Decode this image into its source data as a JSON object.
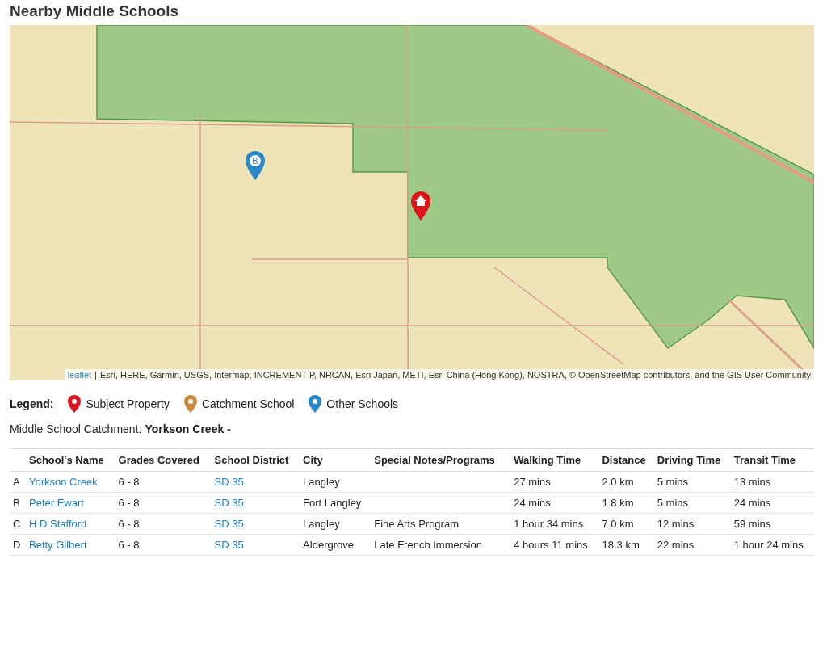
{
  "title": "Nearby Middle Schools",
  "map": {
    "markers": [
      {
        "kind": "school",
        "label": "B",
        "color": "#2a88c9"
      },
      {
        "kind": "property",
        "color": "#e0131b"
      }
    ],
    "attribution": {
      "link": "leaflet",
      "separator": "|",
      "text": "Esri, HERE, Garmin, USGS, Intermap, INCREMENT P, NRCAN, Esri Japan, METI, Esri China (Hong Kong), NOSTRA, © OpenStreetMap contributors, and the GIS User Community"
    }
  },
  "legend": {
    "label": "Legend:",
    "items": [
      {
        "label": "Subject Property",
        "color": "#e0131b"
      },
      {
        "label": "Catchment School",
        "color": "#c98b3b"
      },
      {
        "label": "Other Schools",
        "color": "#2a88c9"
      }
    ]
  },
  "catchment": {
    "label": "Middle School Catchment:",
    "value": "Yorkson Creek -"
  },
  "table": {
    "columns": [
      "School's Name",
      "Grades Covered",
      "School District",
      "City",
      "Special Notes/Programs",
      "Walking Time",
      "Distance",
      "Driving Time",
      "Transit Time"
    ],
    "rows": [
      {
        "letter": "A",
        "name": "Yorkson Creek",
        "grades": "6 - 8",
        "district": "SD 35",
        "city": "Langley",
        "walking": "27 mins",
        "distance": "2.0 km",
        "driving": "5 mins",
        "transit": "13 mins"
      },
      {
        "letter": "B",
        "name": "Peter Ewart",
        "grades": "6 - 8",
        "district": "SD 35",
        "city": "Fort Langley",
        "walking": "24 mins",
        "distance": "1.8 km",
        "driving": "5 mins",
        "transit": "24 mins"
      },
      {
        "letter": "C",
        "name": "H D Stafford",
        "grades": "6 - 8",
        "district": "SD 35",
        "city": "Langley",
        "notes": "Fine Arts Program",
        "walking": "1 hour 34 mins",
        "distance": "7.0 km",
        "driving": "12 mins",
        "transit": "59 mins"
      },
      {
        "letter": "D",
        "name": "Betty Gilbert",
        "grades": "6 - 8",
        "district": "SD 35",
        "city": "Aldergrove",
        "notes": "Late French Immersion",
        "walking": "4 hours 11 mins",
        "distance": "18.3 km",
        "driving": "22 mins",
        "transit": "1 hour 24 mins"
      }
    ]
  }
}
